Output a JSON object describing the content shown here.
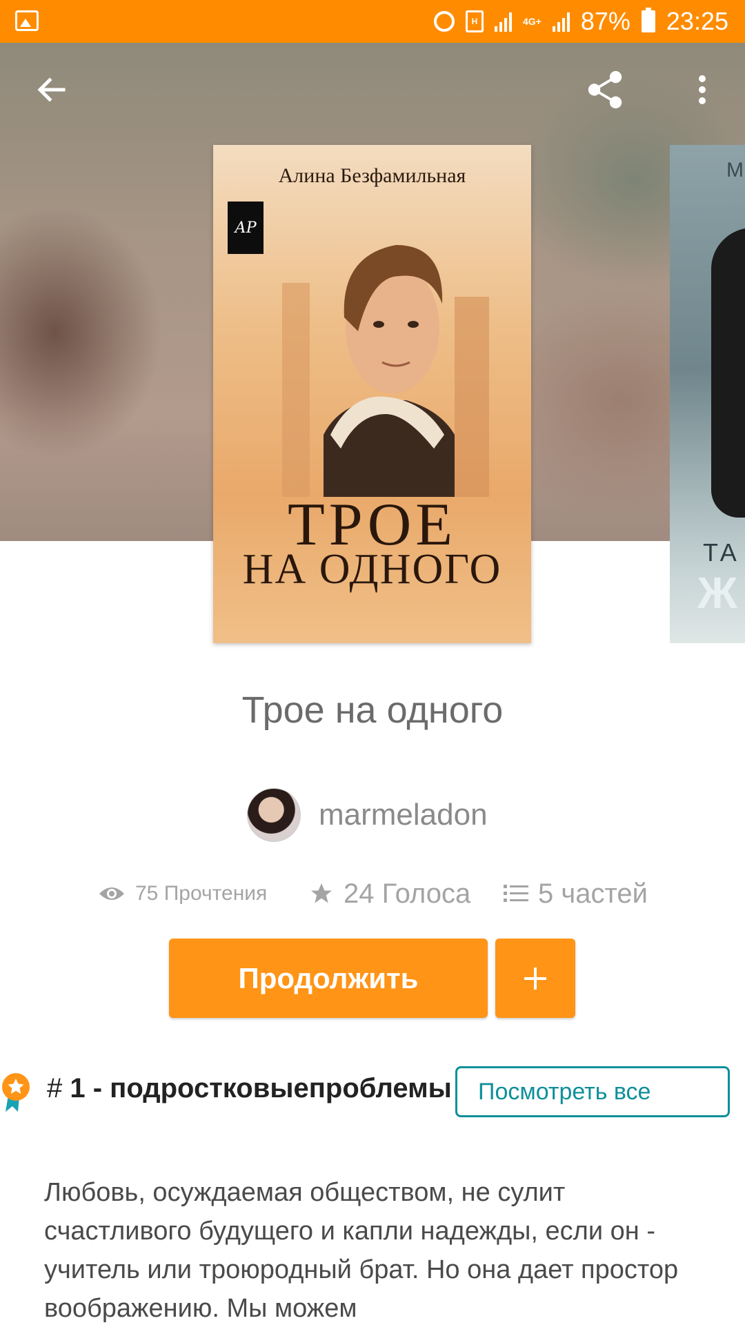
{
  "status_bar": {
    "battery_percent": "87%",
    "time": "23:25",
    "network": "4G+",
    "background_color": "#ff8c00"
  },
  "toolbar": {
    "back_icon": "arrow-left-icon",
    "share_icon": "share-icon",
    "more_icon": "more-vertical-icon"
  },
  "cover": {
    "author_text": "Алина Безфамильная",
    "logo_text": "АР",
    "title_line1": "ТРОЕ",
    "title_line2": "НА ОДНОГО"
  },
  "next_cover": {
    "top_text": "М",
    "mid_text": "ТА",
    "bottom_text": "Ж"
  },
  "book": {
    "title": "Трое на одного",
    "author": "marmeladon"
  },
  "stats": {
    "reads": "75 Прочтения",
    "votes": "24 Голоса",
    "parts": "5 частей"
  },
  "actions": {
    "continue_label": "Продолжить",
    "add_label": "+",
    "accent_color": "#ff9416"
  },
  "ranking": {
    "hash": "#",
    "text": "1 - подростковыепроблемы",
    "view_all_label": "Посмотреть все",
    "link_color": "#0f8f9a"
  },
  "description": "Любовь, осуждаемая обществом, не сулит счастливого будущего и капли надежды, если он - учитель или троюродный брат. Но она дает простор воображению. Мы можем"
}
